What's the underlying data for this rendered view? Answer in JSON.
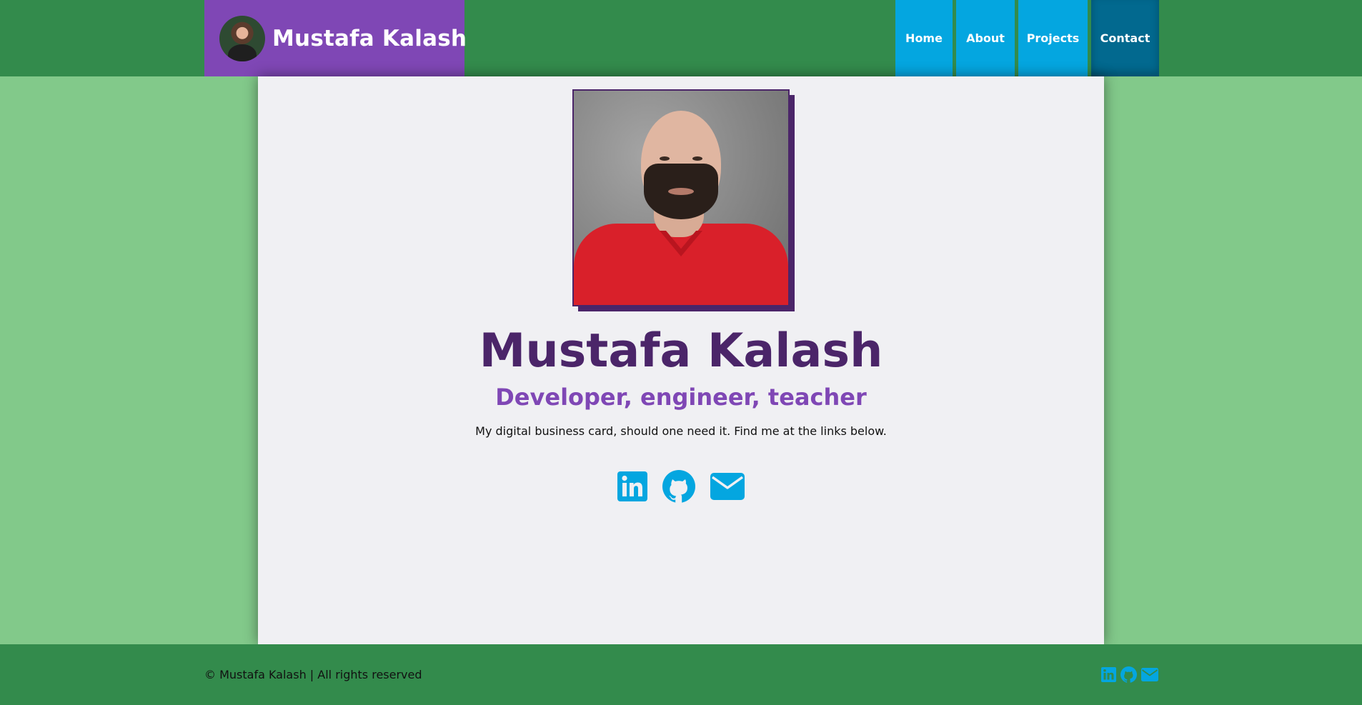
{
  "header": {
    "brand_name": "Mustafa Kalash",
    "nav": [
      {
        "label": "Home",
        "active": false
      },
      {
        "label": "About",
        "active": false
      },
      {
        "label": "Projects",
        "active": false
      },
      {
        "label": "Contact",
        "active": true
      }
    ]
  },
  "main": {
    "name": "Mustafa Kalash",
    "tagline": "Developer, engineer, teacher",
    "blurb": "My digital business card, should one need it. Find me at the links below.",
    "social_icons": [
      "linkedin-icon",
      "github-icon",
      "email-icon"
    ]
  },
  "footer": {
    "copyright": "© Mustafa Kalash | All rights reserved",
    "social_icons": [
      "linkedin-icon",
      "github-icon",
      "email-icon"
    ]
  },
  "colors": {
    "header_bg": "#338b4c",
    "page_bg": "#82c98a",
    "brand_bg": "#7f47b5",
    "nav_bg": "#04a6e0",
    "nav_active_bg": "#02698f",
    "name_color": "#4b2569",
    "tagline_color": "#7f47b5",
    "icon_color": "#04a6e0",
    "card_bg": "#f0f0f3"
  }
}
